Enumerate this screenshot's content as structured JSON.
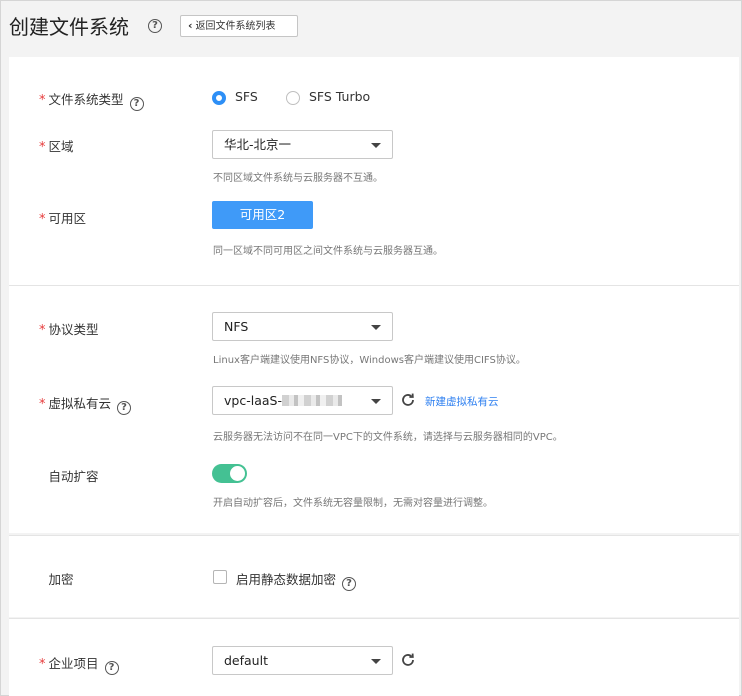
{
  "header": {
    "title": "创建文件系统",
    "back_label": "返回文件系统列表"
  },
  "fs_type": {
    "label": "文件系统类型",
    "options": [
      "SFS",
      "SFS Turbo"
    ],
    "selected": "SFS"
  },
  "region": {
    "label": "区域",
    "value": "华北-北京一",
    "hint": "不同区域文件系统与云服务器不互通。"
  },
  "az": {
    "label": "可用区",
    "button": "可用区2",
    "hint": "同一区域不同可用区之间文件系统与云服务器互通。"
  },
  "protocol": {
    "label": "协议类型",
    "value": "NFS",
    "hint": "Linux客户端建议使用NFS协议，Windows客户端建议使用CIFS协议。"
  },
  "vpc": {
    "label": "虚拟私有云",
    "value_prefix": "vpc-laaS-",
    "create_link": "新建虚拟私有云",
    "hint": "云服务器无法访问不在同一VPC下的文件系统，请选择与云服务器相同的VPC。"
  },
  "auto_expand": {
    "label": "自动扩容",
    "enabled": true,
    "hint": "开启自动扩容后，文件系统无容量限制，无需对容量进行调整。"
  },
  "encryption": {
    "label": "加密",
    "checkbox_label": "启用静态数据加密",
    "checked": false
  },
  "enterprise_project": {
    "label": "企业项目",
    "value": "default"
  },
  "colors": {
    "accent": "#3f9af8",
    "toggle_on": "#44c193",
    "required": "#e63b3b",
    "link": "#2d7ff0"
  }
}
